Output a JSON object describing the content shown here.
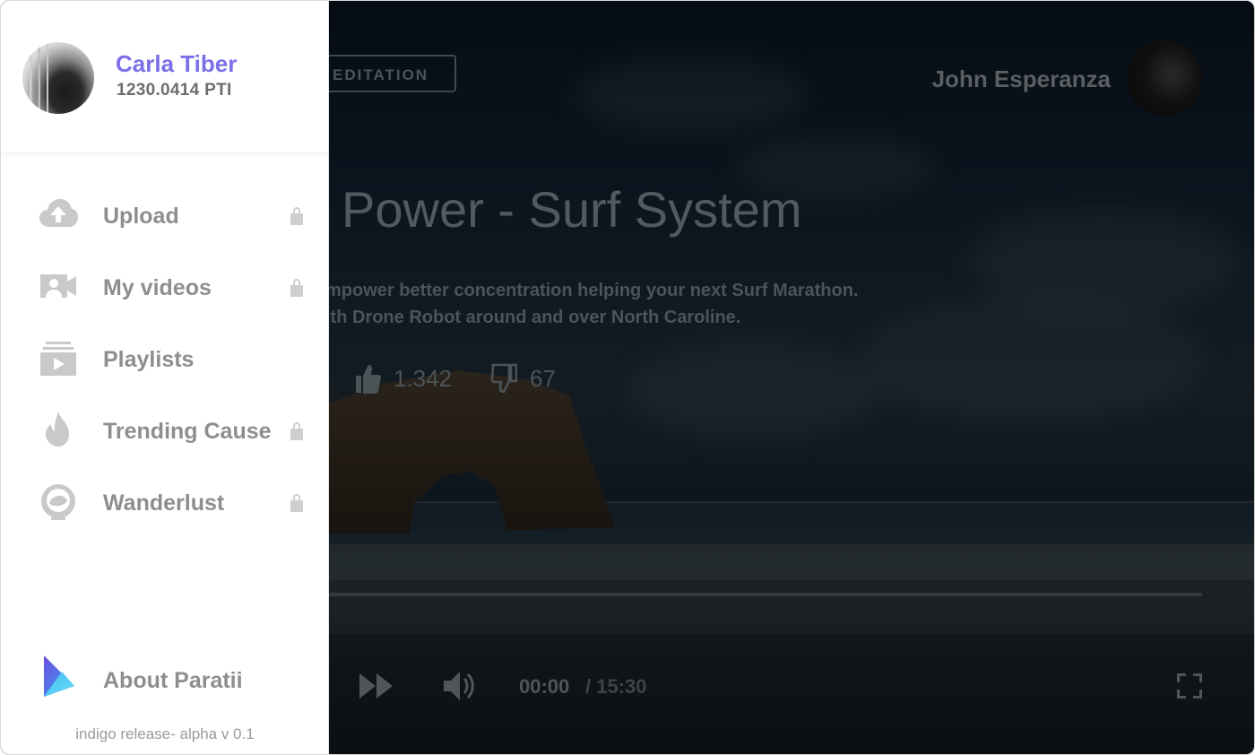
{
  "sidebar": {
    "user": {
      "name": "Carla Tiber",
      "balance": "1230.0414 PTI"
    },
    "menu": [
      {
        "label": "Upload",
        "icon": "cloud-upload-icon",
        "locked": true
      },
      {
        "label": "My videos",
        "icon": "video-camera-icon",
        "locked": true
      },
      {
        "label": "Playlists",
        "icon": "playlist-icon",
        "locked": false
      },
      {
        "label": "Trending Cause",
        "icon": "flame-icon",
        "locked": true
      },
      {
        "label": "Wanderlust",
        "icon": "astronaut-helmet-icon",
        "locked": true
      }
    ],
    "about_label": "About Paratii",
    "release": "indigo release- alpha v 0.1"
  },
  "video": {
    "category": "EDITATION",
    "author": "John Esperanza",
    "title": "Power - Surf System",
    "description_line1": "mpower better concentration helping  your next Surf Marathon.",
    "description_line2": "ith Drone Robot around and over North Caroline.",
    "likes": "1.342",
    "dislikes": "67",
    "current_time": "00:00",
    "duration": "/ 15:30",
    "progress": 0
  },
  "colors": {
    "accent": "#7b6fe8",
    "sidebar_text": "#8e8e8e",
    "icon": "#c9c9c9"
  }
}
